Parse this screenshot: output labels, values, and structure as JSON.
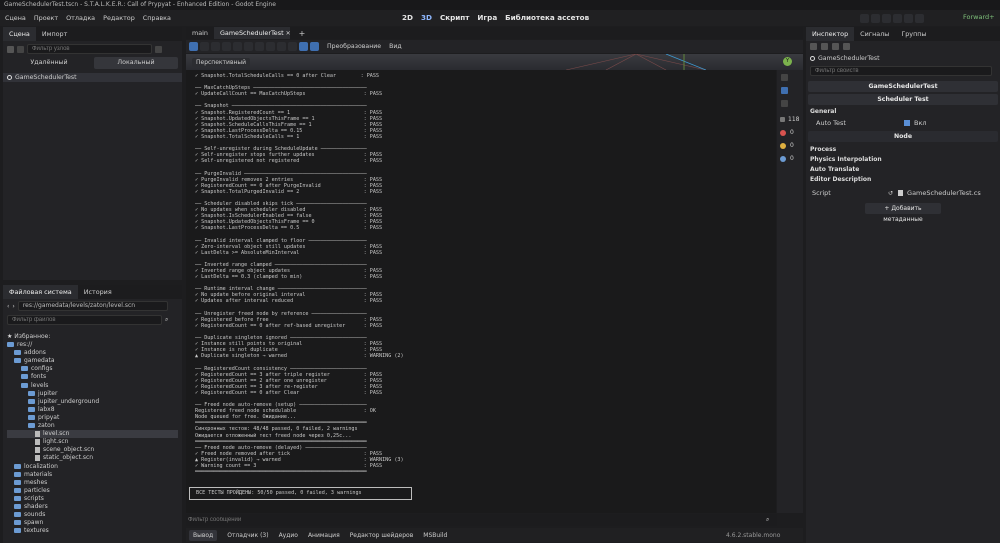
{
  "title": "GameSchedulerTest.tscn - S.T.A.L.K.E.R.: Call of Prypyat - Enhanced Edition - Godot Engine",
  "menu": [
    "Сцена",
    "Проект",
    "Отладка",
    "Редактор",
    "Справка"
  ],
  "workspaces": [
    "2D",
    "3D",
    "Скрипт",
    "Игра",
    "Библиотека ассетов"
  ],
  "renderer": "Forward+",
  "scene_panel": {
    "tabs": [
      "Сцена",
      "Импорт"
    ],
    "filter_placeholder": "Фильтр узлов",
    "remote": "Удалённый",
    "local": "Локальный",
    "root": "GameSchedulerTest"
  },
  "fs_panel": {
    "tabs": [
      "Файловая система",
      "История"
    ],
    "path": "res://gamedata/levels/zaton/level.scn",
    "filter_placeholder": "Фильтр файлов",
    "items": [
      {
        "t": "Избранное:",
        "d": 0,
        "k": "star"
      },
      {
        "t": "res://",
        "d": 0,
        "k": "folder"
      },
      {
        "t": "addons",
        "d": 1,
        "k": "folder"
      },
      {
        "t": "gamedata",
        "d": 1,
        "k": "folder"
      },
      {
        "t": "configs",
        "d": 2,
        "k": "folder"
      },
      {
        "t": "fonts",
        "d": 2,
        "k": "folder"
      },
      {
        "t": "levels",
        "d": 2,
        "k": "folder"
      },
      {
        "t": "jupiter",
        "d": 3,
        "k": "folder"
      },
      {
        "t": "jupiter_underground",
        "d": 3,
        "k": "folder"
      },
      {
        "t": "labx8",
        "d": 3,
        "k": "folder"
      },
      {
        "t": "pripyat",
        "d": 3,
        "k": "folder"
      },
      {
        "t": "zaton",
        "d": 3,
        "k": "folder"
      },
      {
        "t": "level.scn",
        "d": 4,
        "k": "file",
        "sel": true
      },
      {
        "t": "light.scn",
        "d": 4,
        "k": "file"
      },
      {
        "t": "scene_object.scn",
        "d": 4,
        "k": "file"
      },
      {
        "t": "static_object.scn",
        "d": 4,
        "k": "file"
      },
      {
        "t": "localization",
        "d": 1,
        "k": "folder"
      },
      {
        "t": "materials",
        "d": 1,
        "k": "folder"
      },
      {
        "t": "meshes",
        "d": 1,
        "k": "folder"
      },
      {
        "t": "particles",
        "d": 1,
        "k": "folder"
      },
      {
        "t": "scripts",
        "d": 1,
        "k": "folder"
      },
      {
        "t": "shaders",
        "d": 1,
        "k": "folder"
      },
      {
        "t": "sounds",
        "d": 1,
        "k": "folder"
      },
      {
        "t": "spawn",
        "d": 1,
        "k": "folder"
      },
      {
        "t": "textures",
        "d": 1,
        "k": "folder"
      }
    ]
  },
  "editor_tabs": [
    "main",
    "GameSchedulerTest"
  ],
  "viewport": {
    "menus": [
      "Преобразование",
      "Вид"
    ],
    "label": "Перспективный"
  },
  "output": {
    "lines": [
      "✓ Snapshot.TotalScheduleCalls == 0 after Clear        : PASS",
      "",
      "── MaxCatchUpSteps ─────────────────────────────────────",
      "✓ UpdateCallCount == MaxCatchUpSteps                   : PASS",
      "",
      "── Snapshot ────────────────────────────────────────────",
      "✓ Snapshot.RegisteredCount == 1                        : PASS",
      "✓ Snapshot.UpdatedObjectsThisFrame == 1                : PASS",
      "✓ Snapshot.ScheduleCallsThisFrame == 1                 : PASS",
      "✓ Snapshot.LastProcessDelta == 0.15                    : PASS",
      "✓ Snapshot.TotalScheduleCalls == 1                     : PASS",
      "",
      "── Self-unregister during ScheduleUpdate ───────────────",
      "✓ Self-unregister stops further updates                : PASS",
      "✓ Self-unregistered not registered                     : PASS",
      "",
      "── PurgeInvalid ────────────────────────────────────────",
      "✓ PurgeInvalid removes 2 entries                       : PASS",
      "✓ RegisteredCount == 0 after PurgeInvalid              : PASS",
      "✓ Snapshot.TotalPurgedInvalid == 2                     : PASS",
      "",
      "── Scheduler disabled skips tick ───────────────────────",
      "✓ No updates when scheduler disabled                   : PASS",
      "✓ Snapshot.IsSchedulerEnabled == false                 : PASS",
      "✓ Snapshot.UpdatedObjectsThisFrame == 0                : PASS",
      "✓ Snapshot.LastProcessDelta == 0.5                     : PASS",
      "",
      "── Invalid interval clamped to floor ───────────────────",
      "✓ Zero-interval object still updates                   : PASS",
      "✓ LastDelta >= AbsoluteMinInterval                     : PASS",
      "",
      "── Inverted range clamped ──────────────────────────────",
      "✓ Inverted range object updates                        : PASS",
      "✓ LastDelta == 0.3 (clamped to min)                    : PASS",
      "",
      "── Runtime interval change ─────────────────────────────",
      "✓ No update before original interval                   : PASS",
      "✓ Updates after interval reduced                       : PASS",
      "",
      "── Unregister freed node by reference ──────────────────",
      "✓ Registered before free                               : PASS",
      "✓ RegisteredCount == 0 after ref-based unregister      : PASS",
      "",
      "── Duplicate singleton ignored ─────────────────────────",
      "✓ Instance still points to original                    : PASS",
      "✓ Instance is not duplicate                            : PASS",
      "▲ Duplicate singleton → warned                         : WARNING (2)",
      "",
      "── RegisteredCount consistency ─────────────────────────",
      "✓ RegisteredCount == 3 after triple register           : PASS",
      "✓ RegisteredCount == 2 after one unregister            : PASS",
      "✓ RegisteredCount == 3 after re-register               : PASS",
      "✓ RegisteredCount == 0 after Clear                     : PASS",
      "",
      "── Freed node auto-remove (setup) ──────────────────────",
      "Registered freed node schedulable                      : OK",
      "Node queued for free. Ожидание...",
      "════════════════════════════════════════════════════════",
      "Синхронных тестов: 48/48 passed, 0 failed, 2 warnings",
      "Ожидается отложенный тест freed node через 0,25с...",
      "════════════════════════════════════════════════════════",
      "── Freed node auto-remove (delayed) ────────────────────",
      "✓ Freed node removed after tick                        : PASS",
      "▲ Register(invalid) → warned                           : WARNING (3)",
      "✓ Warning count == 3                                   : PASS",
      "════════════════════════════════════════════════════════"
    ],
    "summary": "ВСЕ ТЕСТЫ ПРОЙДЕНЫ: 50/50 passed, 0 failed, 3 warnings",
    "filter_placeholder": "Фильтр сообщений",
    "badges": [
      "118",
      "0",
      "0",
      "0"
    ]
  },
  "bottom_tabs": [
    "Вывод",
    "Отладчик (3)",
    "Аудио",
    "Анимация",
    "Редактор шейдеров",
    "MSBuild"
  ],
  "version": "4.6.2.stable.mono",
  "inspector": {
    "tabs": [
      "Инспектор",
      "Сигналы",
      "Группы"
    ],
    "object": "GameSchedulerTest",
    "filter_placeholder": "Фильтр свойств",
    "header1": "GameSchedulerTest",
    "header2": "Scheduler Test",
    "general": "General",
    "auto_test_label": "Auto Test",
    "auto_test_value": "Вкл",
    "node_section": "Node",
    "groups": [
      "Process",
      "Physics Interpolation",
      "Auto Translate",
      "Editor Description"
    ],
    "script_label": "Script",
    "script_value": "GameSchedulerTest.cs",
    "add_meta": "Добавить метаданные"
  }
}
